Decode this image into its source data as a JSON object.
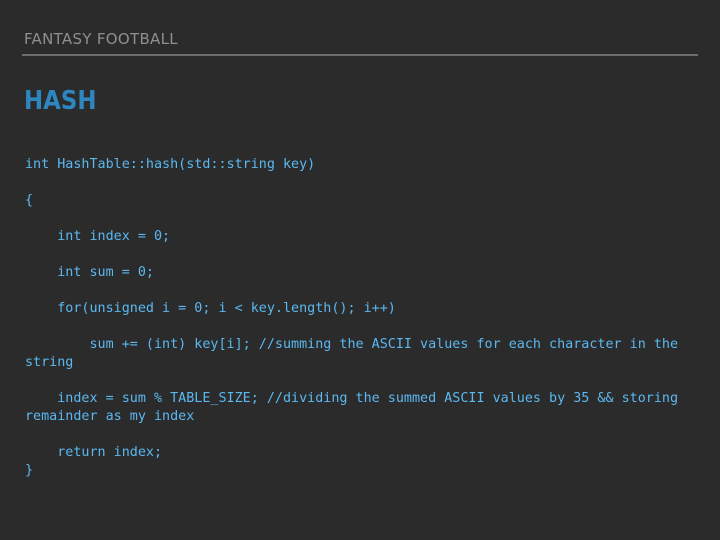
{
  "header": {
    "title": "FANTASY FOOTBALL"
  },
  "slide": {
    "title": "HASH"
  },
  "code": {
    "lines": [
      "int HashTable::hash(std::string key)",
      "{",
      "    int index = 0;",
      "    int sum = 0;",
      "    for(unsigned i = 0; i < key.length(); i++)",
      "        sum += (int) key[i]; //summing the ASCII values for each character in the string",
      "    index = sum % TABLE_SIZE; //dividing the summed ASCII values by 35 && storing remainder as my index",
      "    return index;",
      "}"
    ]
  },
  "colors": {
    "background": "#2b2b2b",
    "header_text": "#8f8f8f",
    "rule": "#6e6e6e",
    "title": "#2e86c1",
    "code_text": "#5bb8f0"
  }
}
